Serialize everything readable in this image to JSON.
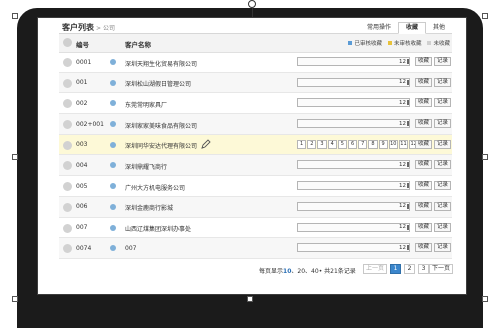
{
  "page": {
    "title": "客户列表",
    "crumb_sep": ">",
    "crumb": "公司"
  },
  "tabs": [
    {
      "label": "常用操作",
      "active": false
    },
    {
      "label": "收藏",
      "active": true
    },
    {
      "label": "其他",
      "active": false
    }
  ],
  "table": {
    "col_code": "编号",
    "col_name": "客户名称",
    "legend": [
      {
        "label": "已审核收藏",
        "color": "#5b9bd5"
      },
      {
        "label": "未审核收藏",
        "color": "#e8c23a"
      },
      {
        "label": "未收藏",
        "color": "#d0d0d0"
      }
    ],
    "rows": [
      {
        "code": "0001",
        "name": "深圳天翔生化贸易有限公司",
        "count": "12",
        "fav": "收藏",
        "rec": "记录"
      },
      {
        "code": "001",
        "name": "深圳松山湖假日管理公司",
        "count": "12",
        "fav": "收藏",
        "rec": "记录"
      },
      {
        "code": "002",
        "name": "东莞常明家具厂",
        "count": "12",
        "fav": "收藏",
        "rec": "记录"
      },
      {
        "code": "002+001",
        "name": "深圳家家美味食品有限公司",
        "count": "12",
        "fav": "收藏",
        "rec": "记录"
      },
      {
        "code": "003",
        "name": "深圳同华安达代理有限公司",
        "count": "12",
        "fav": "收藏",
        "rec": "记录",
        "pages": [
          "1",
          "2",
          "3",
          "4",
          "5",
          "6",
          "7",
          "8",
          "9",
          "10",
          "11",
          "12"
        ]
      },
      {
        "code": "004",
        "name": "深圳鼎耀飞商行",
        "count": "12",
        "fav": "收藏",
        "rec": "记录"
      },
      {
        "code": "005",
        "name": "广州大方机电服务公司",
        "count": "12",
        "fav": "收藏",
        "rec": "记录"
      },
      {
        "code": "006",
        "name": "深圳金鹿商行影城",
        "count": "12",
        "fav": "收藏",
        "rec": "记录"
      },
      {
        "code": "007",
        "name": "山西辽煤集团深圳办事处",
        "count": "12",
        "fav": "收藏",
        "rec": "记录"
      },
      {
        "code": "0074",
        "name": "007",
        "count": "12",
        "fav": "收藏",
        "rec": "记录"
      }
    ]
  },
  "pager": {
    "prefix": "每页显示",
    "size_10": "10",
    "sep1": "、",
    "size_20": "20",
    "sep2": "、",
    "size_40": "40",
    "mid": "• 共",
    "total": "21",
    "suffix": "条记录",
    "prev": "上一页",
    "pages": [
      "1",
      "2",
      "3"
    ],
    "current_page": "1",
    "next": "下一页"
  }
}
